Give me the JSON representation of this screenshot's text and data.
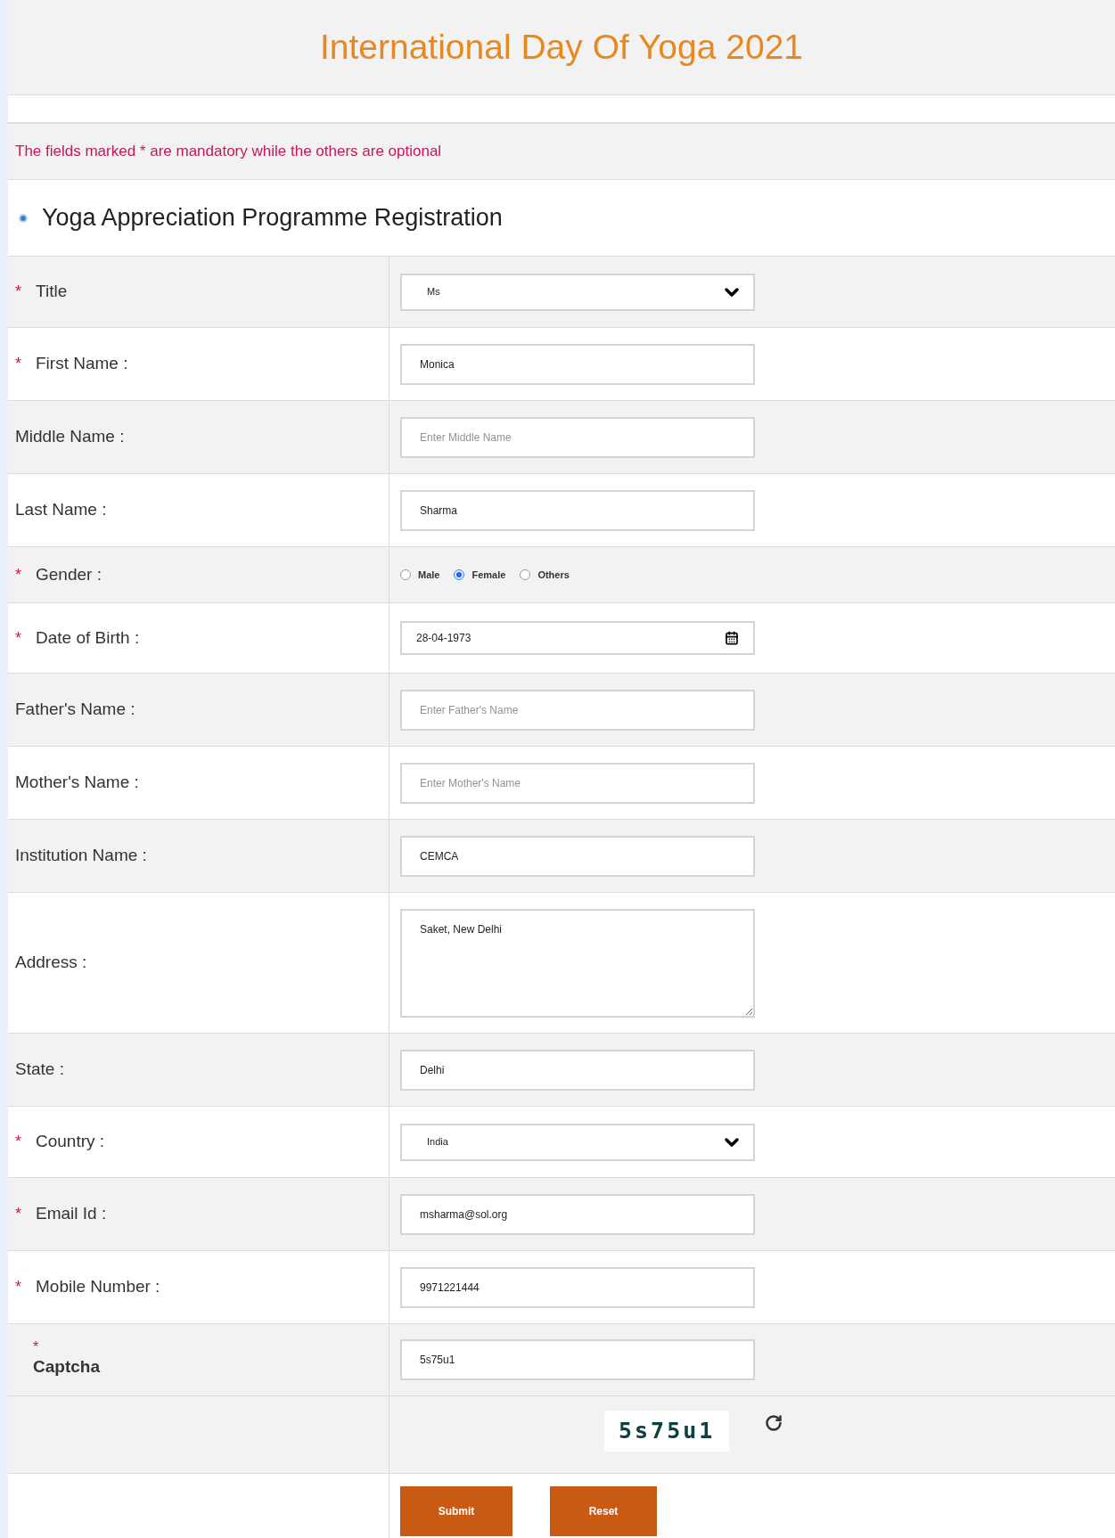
{
  "header": {
    "title": "International Day Of Yoga 2021"
  },
  "notice": "The fields marked * are mandatory while the others are optional",
  "section": {
    "title": "Yoga Appreciation Programme Registration"
  },
  "fields": [
    {
      "kind": "select",
      "required_mark": "*",
      "label": "Title",
      "value": "Ms"
    },
    {
      "kind": "text",
      "required_mark": "*",
      "label": "First Name :",
      "value": "Monica"
    },
    {
      "kind": "text",
      "label": "Middle Name :",
      "placeholder": "Enter Middle Name"
    },
    {
      "kind": "text",
      "label": "Last Name :",
      "value": "Sharma"
    },
    {
      "kind": "radio",
      "required_mark": "*",
      "label": "Gender :",
      "options": [
        {
          "label": "Male",
          "selected": false
        },
        {
          "label": "Female",
          "selected": true
        },
        {
          "label": "Others",
          "selected": false
        }
      ]
    },
    {
      "kind": "date",
      "required_mark": "*",
      "label": "Date of Birth :",
      "value": "28-04-1973"
    },
    {
      "kind": "text",
      "label": "Father's Name :",
      "placeholder": "Enter Father's Name"
    },
    {
      "kind": "text",
      "label": "Mother's Name :",
      "placeholder": "Enter Mother's Name"
    },
    {
      "kind": "text",
      "label": "Institution Name :",
      "value": "CEMCA"
    },
    {
      "kind": "textarea",
      "label": "Address :",
      "value": "Saket, New Delhi"
    },
    {
      "kind": "text",
      "label": "State :",
      "value": "Delhi"
    },
    {
      "kind": "select",
      "required_mark": "*",
      "label": "Country :",
      "value": "India"
    },
    {
      "kind": "text",
      "required_mark": "*",
      "label": "Email Id :",
      "value": "msharma@sol.org"
    },
    {
      "kind": "text",
      "required_mark": "*",
      "label": "Mobile Number :",
      "value": "9971221444"
    },
    {
      "kind": "captcha",
      "required_mark": "*",
      "label": "Captcha",
      "value": "5s75u1"
    }
  ],
  "captcha_image": {
    "text": "5s75u1"
  },
  "buttons": [
    "Submit",
    "Reset"
  ]
}
